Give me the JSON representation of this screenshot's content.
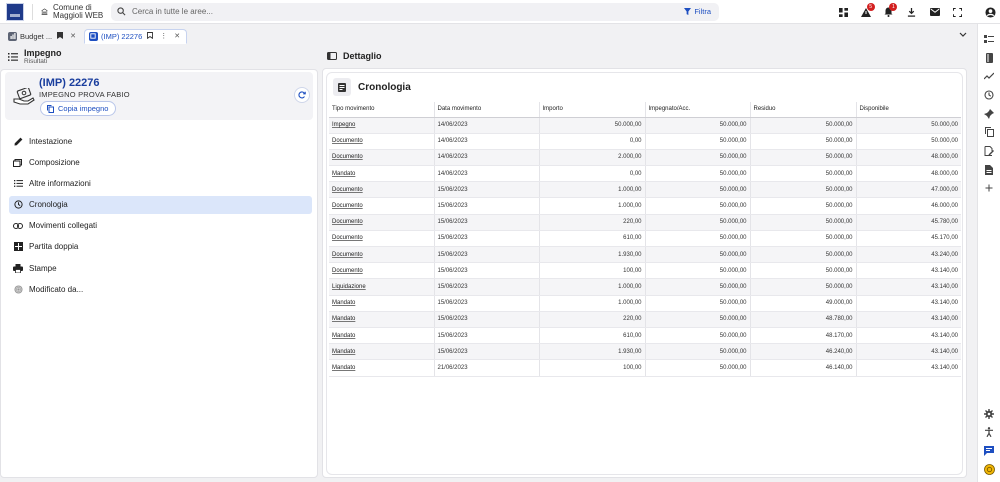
{
  "app": {
    "name_line1": "Comune di",
    "name_line2": "Maggioli WEB"
  },
  "search": {
    "placeholder": "Cerca in tutte le aree...",
    "filter_label": "Filtra"
  },
  "notifications": {
    "alerts_badge": "5",
    "bell_badge": "1"
  },
  "tabs": [
    {
      "label": "Budget ...",
      "active": false
    },
    {
      "label": "(IMP) 22276",
      "active": true
    }
  ],
  "left_header": {
    "title": "Impegno",
    "subtitle": "Risultati"
  },
  "right_header": {
    "title": "Dettaglio"
  },
  "card": {
    "title": "(IMP) 22276",
    "subtitle": "IMPEGNO PROVA FABIO",
    "copy_label": "Copia impegno"
  },
  "menu": [
    {
      "label": "Intestazione",
      "icon": "pencil-icon",
      "active": false
    },
    {
      "label": "Composizione",
      "icon": "stack-icon",
      "active": false
    },
    {
      "label": "Altre informazioni",
      "icon": "list-icon",
      "active": false
    },
    {
      "label": "Cronologia",
      "icon": "history-icon",
      "active": true
    },
    {
      "label": "Movimenti collegati",
      "icon": "link-icon",
      "active": false
    },
    {
      "label": "Partita doppia",
      "icon": "grid-icon",
      "active": false
    },
    {
      "label": "Stampe",
      "icon": "printer-icon",
      "active": false
    },
    {
      "label": "Modificato da...",
      "icon": "fingerprint-icon",
      "active": false
    }
  ],
  "section": {
    "title": "Cronologia"
  },
  "table": {
    "columns": [
      "Tipo movimento",
      "Data movimento",
      "Importo",
      "Impegnato/Acc.",
      "Residuo",
      "Disponibile"
    ],
    "rows": [
      [
        "Impegno",
        "14/06/2023",
        "50.000,00",
        "50.000,00",
        "50.000,00",
        "50.000,00"
      ],
      [
        "Documento",
        "14/06/2023",
        "0,00",
        "50.000,00",
        "50.000,00",
        "50.000,00"
      ],
      [
        "Documento",
        "14/06/2023",
        "2.000,00",
        "50.000,00",
        "50.000,00",
        "48.000,00"
      ],
      [
        "Mandato",
        "14/06/2023",
        "0,00",
        "50.000,00",
        "50.000,00",
        "48.000,00"
      ],
      [
        "Documento",
        "15/06/2023",
        "1.000,00",
        "50.000,00",
        "50.000,00",
        "47.000,00"
      ],
      [
        "Documento",
        "15/06/2023",
        "1.000,00",
        "50.000,00",
        "50.000,00",
        "46.000,00"
      ],
      [
        "Documento",
        "15/06/2023",
        "220,00",
        "50.000,00",
        "50.000,00",
        "45.780,00"
      ],
      [
        "Documento",
        "15/06/2023",
        "610,00",
        "50.000,00",
        "50.000,00",
        "45.170,00"
      ],
      [
        "Documento",
        "15/06/2023",
        "1.930,00",
        "50.000,00",
        "50.000,00",
        "43.240,00"
      ],
      [
        "Documento",
        "15/06/2023",
        "100,00",
        "50.000,00",
        "50.000,00",
        "43.140,00"
      ],
      [
        "Liquidazione",
        "15/06/2023",
        "1.000,00",
        "50.000,00",
        "50.000,00",
        "43.140,00"
      ],
      [
        "Mandato",
        "15/06/2023",
        "1.000,00",
        "50.000,00",
        "49.000,00",
        "43.140,00"
      ],
      [
        "Mandato",
        "15/06/2023",
        "220,00",
        "50.000,00",
        "48.780,00",
        "43.140,00"
      ],
      [
        "Mandato",
        "15/06/2023",
        "610,00",
        "50.000,00",
        "48.170,00",
        "43.140,00"
      ],
      [
        "Mandato",
        "15/06/2023",
        "1.930,00",
        "50.000,00",
        "46.240,00",
        "43.140,00"
      ],
      [
        "Mandato",
        "21/06/2023",
        "100,00",
        "50.000,00",
        "46.140,00",
        "43.140,00"
      ]
    ]
  },
  "colors": {
    "accent": "#1e4fc1",
    "active_bg": "#dbe6fa",
    "badge": "#d32020"
  }
}
